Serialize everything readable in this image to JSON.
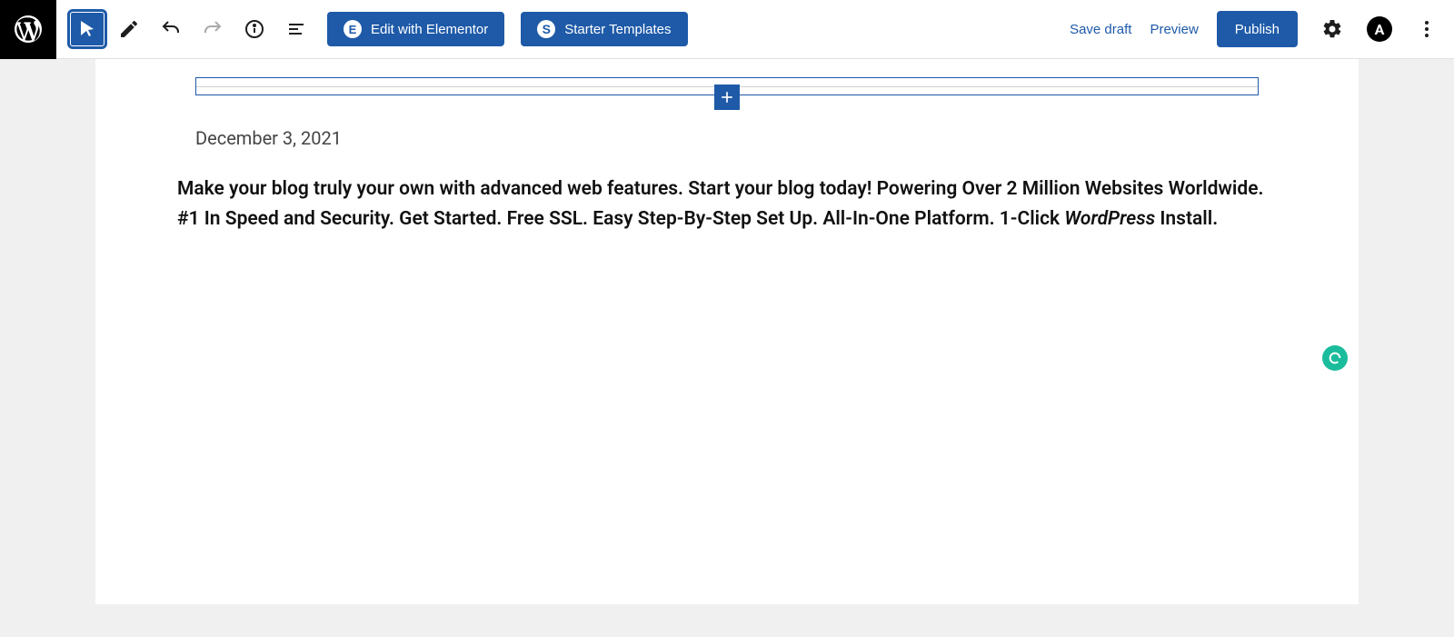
{
  "toolbar": {
    "elementor_label": "Edit with Elementor",
    "starter_templates_label": "Starter Templates",
    "save_draft_label": "Save draft",
    "preview_label": "Preview",
    "publish_label": "Publish"
  },
  "editor": {
    "date_text": "December 3, 2021",
    "excerpt_pre": "Make your blog truly your own with advanced web features. Start your blog today! Powering Over 2 Million Websites Worldwide. #1 In Speed and Security. Get Started. Free SSL. Easy Step-By-Step Set Up. All-In-One Platform. 1-Click ",
    "excerpt_emph": "WordPress",
    "excerpt_post": " Install."
  },
  "icons": {
    "wordpress": "wordpress-logo",
    "select": "cursor-icon",
    "edit": "pencil-icon",
    "undo": "undo-icon",
    "redo": "redo-icon",
    "info": "info-icon",
    "outline": "outline-icon",
    "settings": "gear-icon",
    "avatar_letter": "A",
    "more": "more-icon",
    "add": "plus-icon",
    "grammarly": "G"
  }
}
